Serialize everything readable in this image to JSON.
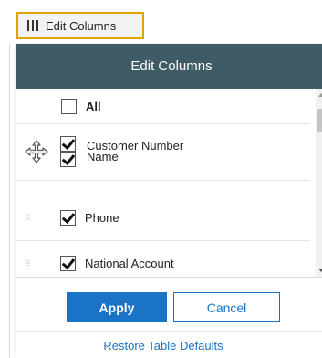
{
  "trigger": {
    "label": "Edit Columns",
    "icon": "columns-icon"
  },
  "panel": {
    "title": "Edit Columns",
    "all_label": "All",
    "columns": [
      {
        "label_line1": "Customer Number",
        "label_line2": "Name",
        "checked": true
      },
      {
        "label": "Phone",
        "checked": true
      },
      {
        "label": "National Account",
        "checked": true
      }
    ],
    "drag_handle": "⁞⁞"
  },
  "footer": {
    "apply_label": "Apply",
    "cancel_label": "Cancel",
    "restore_label": "Restore Table Defaults"
  },
  "colors": {
    "header_bg": "#3e5b66",
    "primary": "#1a73c7",
    "trigger_border": "#e0a400"
  }
}
